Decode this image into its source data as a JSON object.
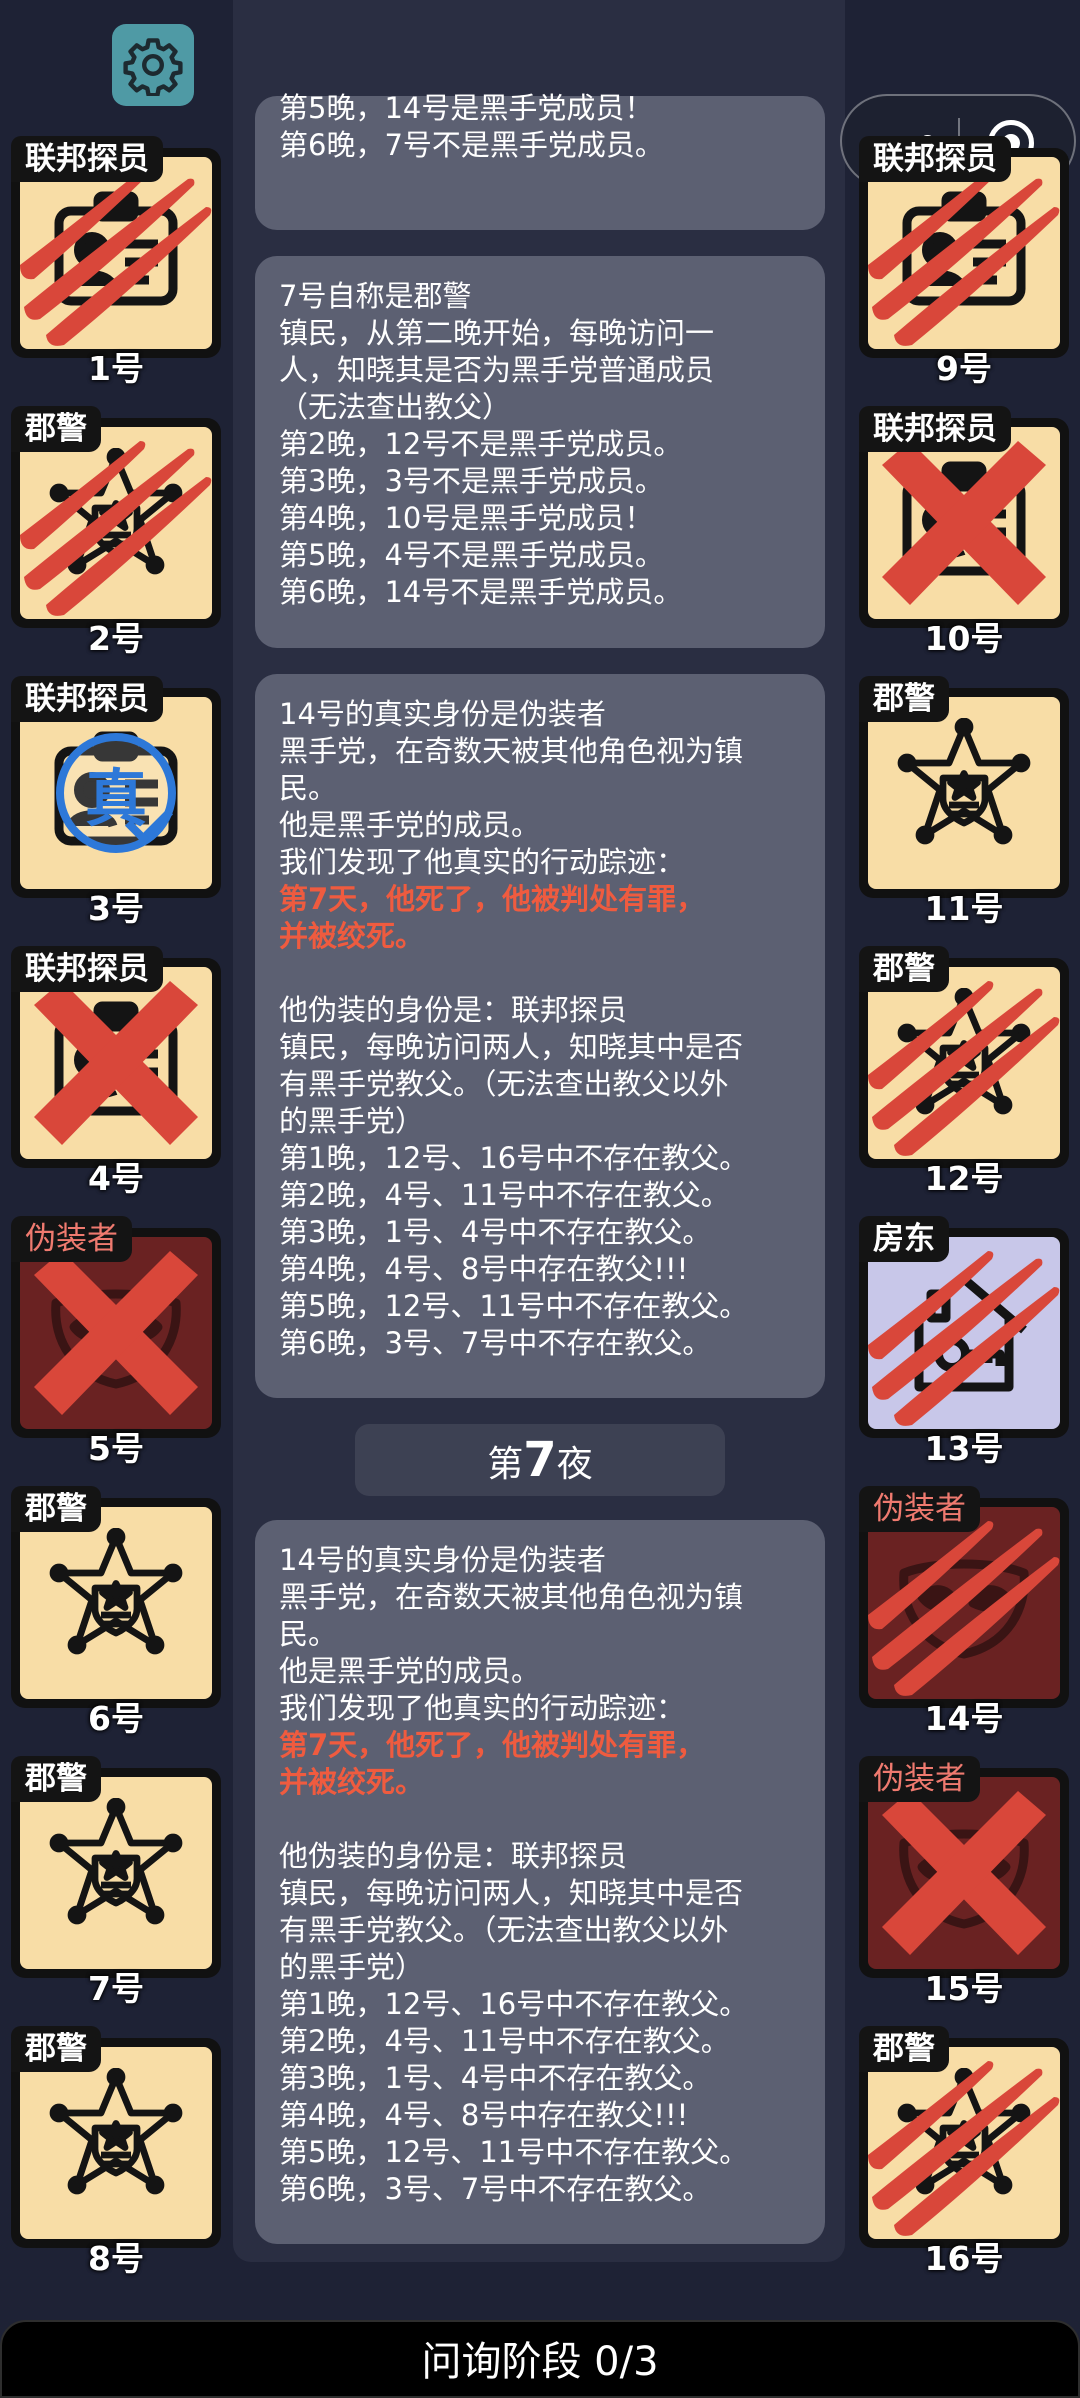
{
  "header": {
    "settings_icon": "gear-icon"
  },
  "miniprogram": {
    "menu_icon": "more-dots-icon",
    "close_icon": "target-circle-icon"
  },
  "players_left": [
    {
      "number": "1号",
      "role": "联邦探员",
      "emblem": "badge-card-icon",
      "state": "slashed"
    },
    {
      "number": "2号",
      "role": "郡警",
      "emblem": "sheriff-star-icon",
      "state": "slashed"
    },
    {
      "number": "3号",
      "role": "联邦探员",
      "emblem": "badge-card-icon",
      "state": "verified",
      "stamp": "真"
    },
    {
      "number": "4号",
      "role": "联邦探员",
      "emblem": "badge-card-icon",
      "state": "crossed"
    },
    {
      "number": "5号",
      "role": "伪装者",
      "emblem": "mask-icon",
      "state": "crossed"
    },
    {
      "number": "6号",
      "role": "郡警",
      "emblem": "sheriff-star-icon",
      "state": "normal"
    },
    {
      "number": "7号",
      "role": "郡警",
      "emblem": "sheriff-star-icon",
      "state": "normal"
    },
    {
      "number": "8号",
      "role": "郡警",
      "emblem": "sheriff-star-icon",
      "state": "normal"
    }
  ],
  "players_right": [
    {
      "number": "9号",
      "role": "联邦探员",
      "emblem": "badge-card-icon",
      "state": "slashed"
    },
    {
      "number": "10号",
      "role": "联邦探员",
      "emblem": "badge-card-icon",
      "state": "crossed"
    },
    {
      "number": "11号",
      "role": "郡警",
      "emblem": "sheriff-star-icon",
      "state": "normal"
    },
    {
      "number": "12号",
      "role": "郡警",
      "emblem": "sheriff-star-icon",
      "state": "slashed"
    },
    {
      "number": "13号",
      "role": "房东",
      "emblem": "house-icon",
      "state": "slashed"
    },
    {
      "number": "14号",
      "role": "伪装者",
      "emblem": "mask-icon",
      "state": "slashed"
    },
    {
      "number": "15号",
      "role": "伪装者",
      "emblem": "mask-icon",
      "state": "crossed"
    },
    {
      "number": "16号",
      "role": "郡警",
      "emblem": "sheriff-star-icon",
      "state": "slashed"
    }
  ],
  "log": {
    "box0": [
      "第5晚，14号是黑手党成员！",
      "第6晚，7号不是黑手党成员。"
    ],
    "box1": [
      "7号自称是郡警",
      "镇民，从第二晚开始，每晚访问一",
      "人，知晓其是否为黑手党普通成员",
      "（无法查出教父）",
      "第2晚，12号不是黑手党成员。",
      "第3晚，3号不是黑手党成员。",
      "第4晚，10号是黑手党成员！",
      "第5晚，4号不是黑手党成员。",
      "第6晚，14号不是黑手党成员。"
    ],
    "box2": {
      "intro": [
        "14号的真实身份是伪装者",
        "黑手党，在奇数天被其他角色视为镇",
        "民。",
        "他是黑手党的成员。",
        "我们发现了他真实的行动踪迹："
      ],
      "highlight": [
        "第7天，他死了，他被判处有罪，",
        "并被绞死。"
      ],
      "disguise": [
        "他伪装的身份是：联邦探员",
        "镇民，每晚访问两人，知晓其中是否",
        "有黑手党教父。（无法查出教父以外",
        "的黑手党）",
        "第1晚，12号、16号中不存在教父。",
        "第2晚，4号、11号中不存在教父。",
        "第3晚，1号、4号中不存在教父。",
        "第4晚，4号、8号中存在教父!!!",
        "第5晚，12号、11号中不存在教父。",
        "第6晚，3号、7号中不存在教父。"
      ]
    },
    "night_prefix": "第",
    "night_number": "7",
    "night_suffix": "夜",
    "box3": {
      "intro": [
        "14号的真实身份是伪装者",
        "黑手党，在奇数天被其他角色视为镇",
        "民。",
        "他是黑手党的成员。",
        "我们发现了他真实的行动踪迹："
      ],
      "highlight": [
        "第7天，他死了，他被判处有罪，",
        "并被绞死。"
      ],
      "disguise": [
        "他伪装的身份是：联邦探员",
        "镇民，每晚访问两人，知晓其中是否",
        "有黑手党教父。（无法查出教父以外",
        "的黑手党）",
        "第1晚，12号、16号中不存在教父。",
        "第2晚，4号、11号中不存在教父。",
        "第3晚，1号、4号中不存在教父。",
        "第4晚，4号、8号中存在教父!!!",
        "第5晚，12号、11号中不存在教父。",
        "第6晚，3号、7号中不存在教父。"
      ]
    }
  },
  "footer": {
    "phase_label": "问询阶段 0/3"
  },
  "colors": {
    "card_bg": "#f8dda6",
    "imposter_bg": "#6a2222",
    "landlord_bg": "#c8c7e9",
    "slash": "#d9473a",
    "highlight_text": "#ef5b3f",
    "stamp": "#2d78d8"
  }
}
